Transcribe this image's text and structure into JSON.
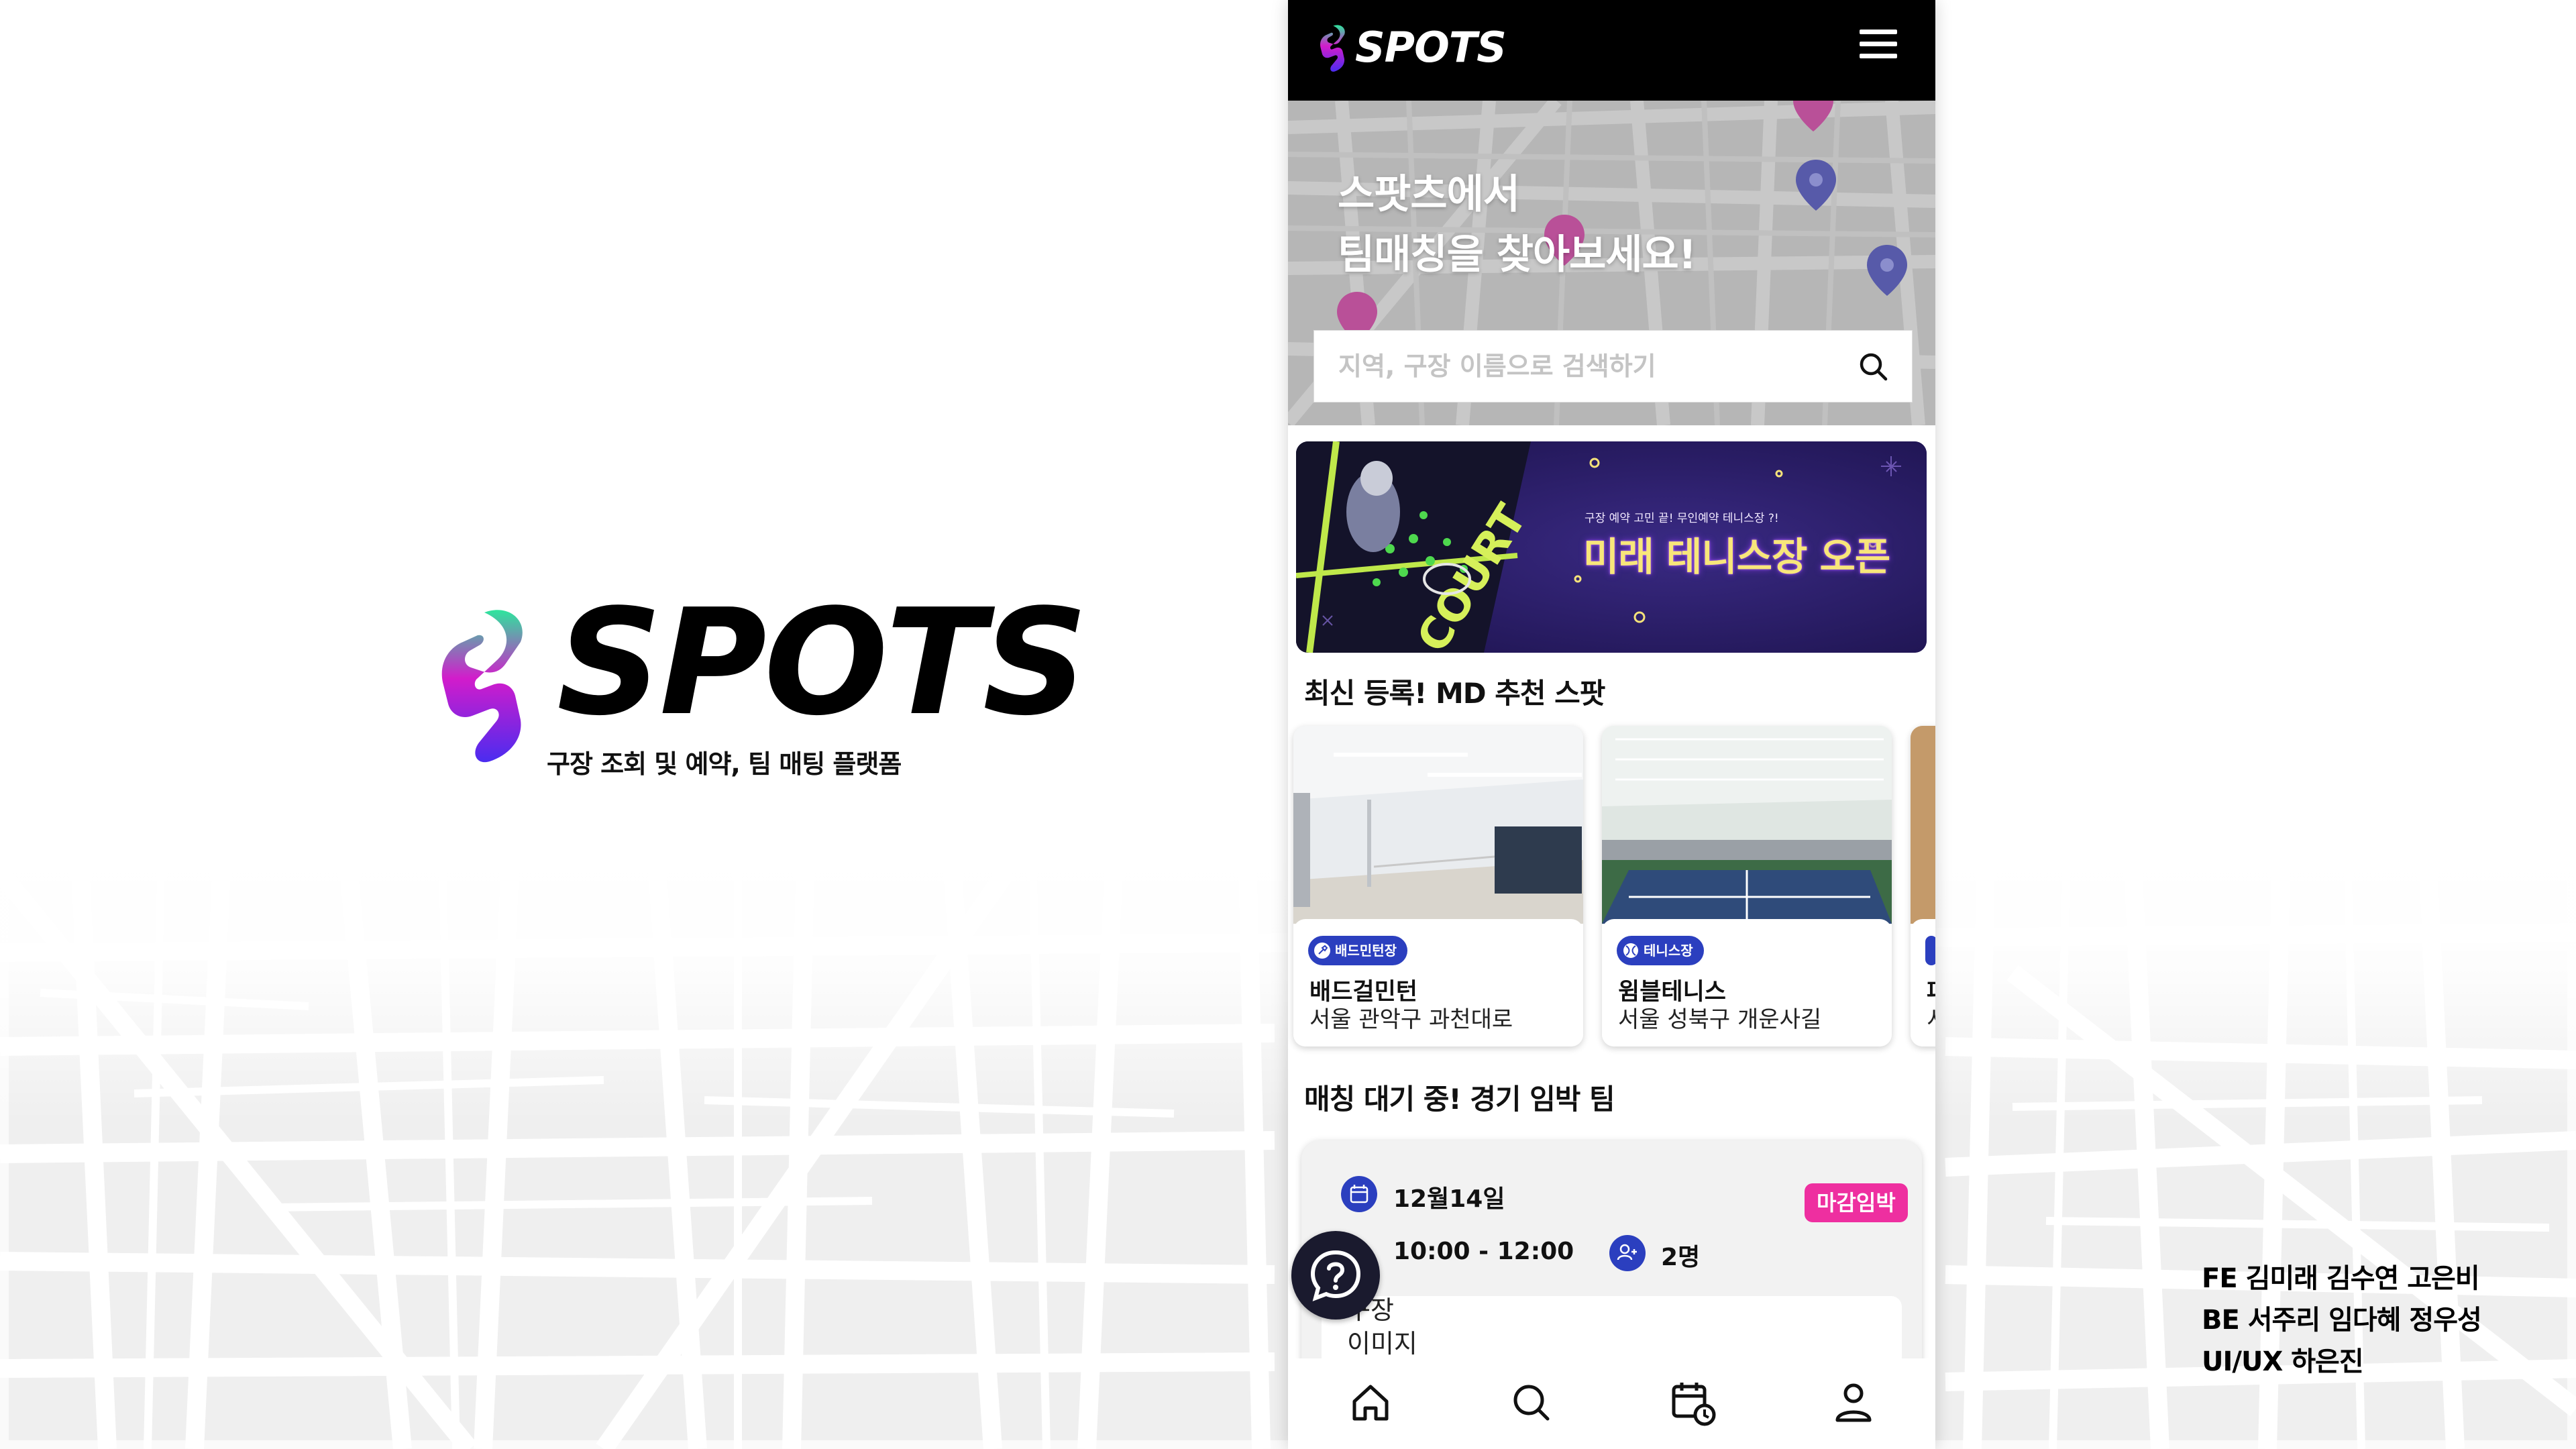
{
  "colors": {
    "brand_gradient": [
      "#2EE59D",
      "#D21CCB",
      "#4A2CF0"
    ],
    "header_bg": "#000000",
    "badge_blue": "#2b3fbf",
    "deadline_pink": "#ee2fa0"
  },
  "brand": {
    "wordmark": "SPOTS",
    "tagline": "구장 조회 및  예약, 팀 매팅 플랫폼"
  },
  "credits": {
    "fe": "FE 김미래 김수연 고은비",
    "be": "BE 서주리 임다혜 정우성",
    "uiux": "UI/UX 하은진"
  },
  "app": {
    "header": {
      "logo_text": "SPOTS",
      "menu_icon": "hamburger-icon"
    },
    "hero": {
      "title_line1": "스팟츠에서",
      "title_line2": "팀매칭을 찾아보세요!",
      "search_placeholder": "지역, 구장 이름으로 검색하기",
      "search_icon": "search-icon"
    },
    "banner": {
      "subtitle": "구장 예약 고민 끝! 무인예약 테니스장 ?!",
      "title": "미래 테니스장 오픈",
      "court_text": "COURT"
    },
    "recommend": {
      "title": "최신 등록! MD 추천 스팟",
      "cards": [
        {
          "badge": "배드민턴장",
          "badge_icon": "badminton-icon",
          "name": "배드걸민턴",
          "address": "서울 관악구 과천대로"
        },
        {
          "badge": "테니스장",
          "badge_icon": "tennis-icon",
          "name": "윔블테니스",
          "address": "서울 성북구 개운사길"
        },
        {
          "badge": "",
          "badge_icon": "sport-icon",
          "name": "파",
          "address": "서"
        }
      ]
    },
    "matching": {
      "title": "매칭 대기 중! 경기 임박 팀",
      "date": "12월14일",
      "time": "10:00 - 12:00",
      "people": "2명",
      "deadline": "마감임박",
      "image_placeholder_line1": "구장",
      "image_placeholder_line2": "이미지"
    },
    "help_icon": "help-chat-icon",
    "bottom_nav": [
      {
        "icon": "home-icon"
      },
      {
        "icon": "search-icon"
      },
      {
        "icon": "calendar-clock-icon"
      },
      {
        "icon": "user-icon"
      }
    ]
  }
}
